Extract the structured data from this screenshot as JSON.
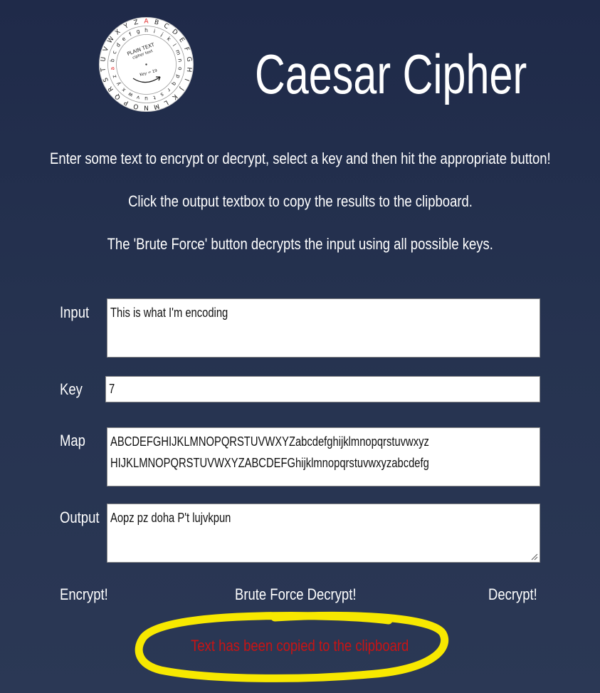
{
  "header": {
    "title": "Caesar Cipher",
    "logo": {
      "outer_letters": [
        "A",
        "B",
        "C",
        "D",
        "E",
        "F",
        "G",
        "H",
        "I",
        "J",
        "K",
        "L",
        "M",
        "N",
        "O",
        "P",
        "Q",
        "R",
        "S",
        "T",
        "U",
        "V",
        "W",
        "X",
        "Y",
        "Z"
      ],
      "inner_letters": [
        "a",
        "b",
        "c",
        "d",
        "e",
        "f",
        "g",
        "h",
        "i",
        "j",
        "k",
        "l",
        "m",
        "n",
        "o",
        "p",
        "q",
        "r",
        "s",
        "t",
        "u",
        "v",
        "w",
        "x",
        "y",
        "z"
      ],
      "plain_text_label": "PLAIN TEXT",
      "cipher_text_label": "cipher text",
      "key_label": "Key = 19"
    }
  },
  "instructions": {
    "line1": "Enter some text to encrypt or decrypt, select a key and then hit the appropriate button!",
    "line2": "Click the output textbox to copy the results to the clipboard.",
    "line3": "The 'Brute Force' button decrypts the input using all possible keys."
  },
  "form": {
    "input_label": "Input",
    "input_value": "This is what I'm encoding",
    "key_label": "Key",
    "key_value": "7",
    "map_label": "Map",
    "map_line1": "ABCDEFGHIJKLMNOPQRSTUVWXYZabcdefghijklmnopqrstuvwxyz",
    "map_line2": "HIJKLMNOPQRSTUVWXYZABCDEFGhijklmnopqrstuvwxyzabcdefg",
    "output_label": "Output",
    "output_value": "Aopz pz doha P't lujvkpun"
  },
  "actions": {
    "encrypt_label": "Encrypt!",
    "brute_force_label": "Brute Force Decrypt!",
    "decrypt_label": "Decrypt!"
  },
  "status": {
    "clipboard_message": "Text has been copied to the clipboard"
  },
  "colors": {
    "background_top": "#1f2a49",
    "background_bottom": "#2b3855",
    "message_red": "#c81414",
    "highlight_yellow": "#f7e800"
  }
}
